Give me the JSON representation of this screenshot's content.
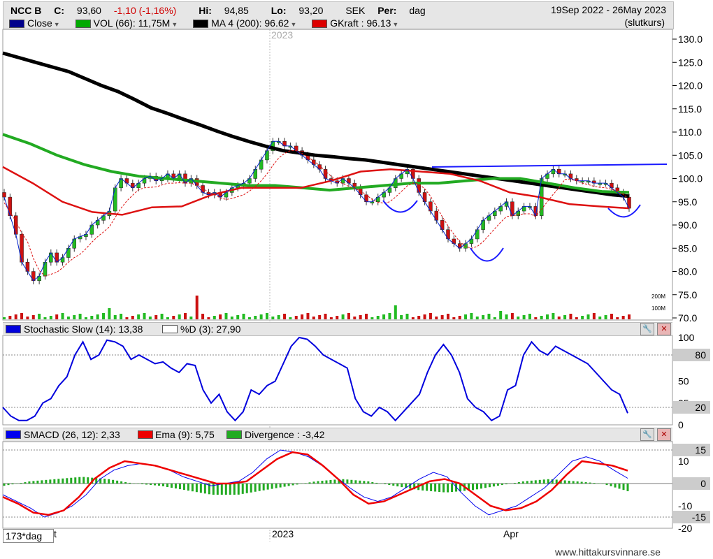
{
  "header": {
    "ticker": "NCC B",
    "close_label": "C:",
    "close_value": "93,60",
    "change": "-1,10 (-1,16%)",
    "high_label": "Hi:",
    "high_value": "94,85",
    "low_label": "Lo:",
    "low_value": "93,20",
    "currency": "SEK",
    "period_label": "Per:",
    "period_value": "dag",
    "date_range": "19Sep 2022 - 26May 2023",
    "price_basis": "(slutkurs)"
  },
  "legend": [
    {
      "label": "Close",
      "color": "#00008b"
    },
    {
      "label": "VOL (66): 11,75M",
      "color": "#00aa00"
    },
    {
      "label": "MA 4 (200): 96.62",
      "color": "#000000"
    },
    {
      "label": "GKraft : 96.13",
      "color": "#dd0000"
    }
  ],
  "main_axis": {
    "ticks": [
      "130.0",
      "125.0",
      "120.0",
      "115.0",
      "110.0",
      "105.0",
      "100.0",
      "95.0",
      "90.0",
      "85.0",
      "80.0",
      "75.0",
      "70.0"
    ],
    "vol_ticks": [
      "200M",
      "100M"
    ]
  },
  "year_label": "2023",
  "stochastic": {
    "title": "Stochastic Slow (14): 13,38",
    "d_label": "%D (3): 27,90",
    "ticks": [
      "100",
      "50",
      "25",
      "0"
    ],
    "levels": [
      "80",
      "20"
    ]
  },
  "macd": {
    "title": "SMACD (26, 12): 2,33",
    "ema_label": "Ema (9): 5,75",
    "div_label": "Divergence : -3,42",
    "ticks": [
      "15",
      "10",
      "0",
      "-10",
      "-15",
      "-20"
    ],
    "levels": [
      "15",
      "0",
      "-15"
    ]
  },
  "xaxis": {
    "labels": [
      "ct",
      "2023",
      "Apr"
    ],
    "period_box": "173*dag"
  },
  "watermark": "www.hittakursvinnare.se",
  "colors": {
    "up": "#22bb22",
    "down": "#cc1111",
    "ma200": "#000000",
    "ma_green": "#22aa22",
    "gkraft": "#dd1111",
    "close": "#0022cc",
    "stoch": "#0000dd",
    "macd": "#0000ee",
    "ema": "#ee0000",
    "div": "#22aa22"
  },
  "chart_data": [
    {
      "type": "line",
      "title": "NCC B",
      "ylim": [
        70,
        130
      ],
      "series": [
        {
          "name": "Close",
          "values": [
            96.0,
            92.0,
            88.0,
            82.0,
            80.0,
            78.0,
            79.0,
            82.0,
            84.0,
            82.0,
            83.0,
            85.0,
            87.0,
            87.5,
            88.0,
            90.0,
            91.0,
            92.0,
            93.0,
            98.0,
            100.0,
            99.0,
            98.0,
            99.0,
            100.0,
            100.5,
            99.5,
            100.0,
            101.0,
            100.0,
            101.0,
            99.0,
            100.0,
            98.5,
            97.0,
            96.5,
            97.0,
            96.0,
            97.0,
            98.0,
            98.5,
            99.0,
            100.0,
            102.0,
            104.0,
            106.0,
            108.0,
            108.0,
            107.0,
            107.0,
            106.0,
            105.0,
            104.0,
            103.0,
            102.0,
            100.0,
            99.5,
            99.0,
            100.0,
            99.0,
            98.0,
            96.5,
            95.0,
            95.0,
            96.0,
            97.0,
            98.0,
            100.0,
            101.0,
            102.0,
            100.0,
            97.0,
            95.0,
            93.0,
            91.0,
            89.0,
            87.0,
            86.0,
            85.0,
            86.0,
            87.0,
            89.0,
            91.0,
            92.0,
            93.0,
            94.0,
            95.0,
            92.0,
            93.0,
            94.0,
            94.0,
            92.0,
            100.0,
            101.0,
            102.0,
            101.0,
            101.0,
            100.0,
            99.5,
            99.5,
            99.5,
            99.0,
            99.0,
            99.0,
            98.0,
            97.0,
            96.0,
            93.6
          ]
        },
        {
          "name": "MA 4 (200)",
          "values": [
            127.0,
            126.0,
            125.0,
            124.0,
            123.0,
            121.5,
            120.0,
            118.7,
            117.0,
            115.2,
            114.0,
            112.7,
            111.5,
            110.2,
            109.0,
            107.9,
            106.9,
            106.0,
            105.5,
            105.0,
            104.7,
            104.3,
            104.0,
            103.5,
            103.0,
            102.5,
            102.0,
            101.5,
            101.0,
            100.5,
            100.0,
            99.5,
            99.0,
            98.5,
            98.0,
            97.5,
            97.0,
            96.5,
            96.2
          ]
        },
        {
          "name": "GKraft",
          "values": [
            102.5,
            99.0,
            95.0,
            92.8,
            92.2,
            93.8,
            94.0,
            96.5,
            98.0,
            98.0,
            98.0,
            99.5,
            101.5,
            102.0,
            101.5,
            101.0,
            99.5,
            97.0,
            96.0,
            94.5,
            94.0,
            93.6
          ]
        },
        {
          "name": "VOL (66)",
          "values": [
            109.5,
            107.5,
            105.0,
            103.0,
            101.5,
            100.5,
            100.0,
            99.5,
            99.0,
            98.5,
            98.5,
            98.0,
            97.5,
            98.0,
            98.5,
            99.0,
            99.0,
            99.5,
            100.0,
            100.0,
            99.0,
            98.0,
            97.2,
            97.0
          ]
        }
      ]
    },
    {
      "type": "line",
      "title": "Stochastic Slow (14): 13,38",
      "ylim": [
        0,
        100
      ],
      "series": [
        {
          "name": "Stochastic Slow (14)",
          "values": [
            20,
            10,
            5,
            5,
            10,
            25,
            30,
            45,
            55,
            80,
            95,
            75,
            80,
            97,
            95,
            90,
            75,
            80,
            75,
            70,
            72,
            65,
            60,
            70,
            68,
            40,
            25,
            35,
            15,
            5,
            15,
            40,
            35,
            45,
            50,
            70,
            90,
            100,
            98,
            90,
            80,
            75,
            70,
            65,
            30,
            15,
            10,
            20,
            15,
            5,
            15,
            25,
            35,
            60,
            80,
            92,
            80,
            60,
            30,
            20,
            15,
            5,
            10,
            40,
            45,
            80,
            95,
            85,
            80,
            90,
            85,
            80,
            75,
            70,
            60,
            50,
            40,
            35,
            13.38
          ]
        }
      ]
    },
    {
      "type": "bar",
      "title": "SMACD (26, 12): 2,33",
      "ylim": [
        -20,
        20
      ],
      "series": [
        {
          "name": "SMACD (26, 12)",
          "values": [
            -5,
            -8,
            -11,
            -15,
            -13,
            -10,
            -5,
            2,
            6,
            8,
            9,
            8,
            6,
            3,
            1,
            -1,
            0,
            1,
            5,
            11,
            15,
            14,
            12,
            8,
            3,
            -2,
            -6,
            -8,
            -6,
            -2,
            2,
            5,
            3,
            -4,
            -10,
            -14,
            -12,
            -10,
            -6,
            -2,
            4,
            10,
            12,
            10,
            6,
            2.33
          ]
        },
        {
          "name": "Ema (9)",
          "values": [
            -6,
            -9,
            -13,
            -14,
            -12,
            -6,
            2,
            7,
            10,
            9,
            8,
            6,
            4,
            2,
            0,
            0,
            1,
            6,
            11,
            14,
            13,
            8,
            2,
            -5,
            -9,
            -8,
            -5,
            -2,
            1,
            2,
            0,
            -5,
            -10,
            -12,
            -11,
            -8,
            -3,
            4,
            10,
            9,
            8,
            5.75
          ]
        },
        {
          "name": "Divergence",
          "values": [
            -1,
            1,
            2,
            3,
            2,
            0,
            -1,
            -3,
            -5,
            -5,
            -3,
            -1,
            1,
            2,
            1,
            -1,
            -3,
            -4,
            -3,
            -1,
            1,
            2,
            1,
            0,
            -3.42
          ]
        }
      ]
    }
  ]
}
